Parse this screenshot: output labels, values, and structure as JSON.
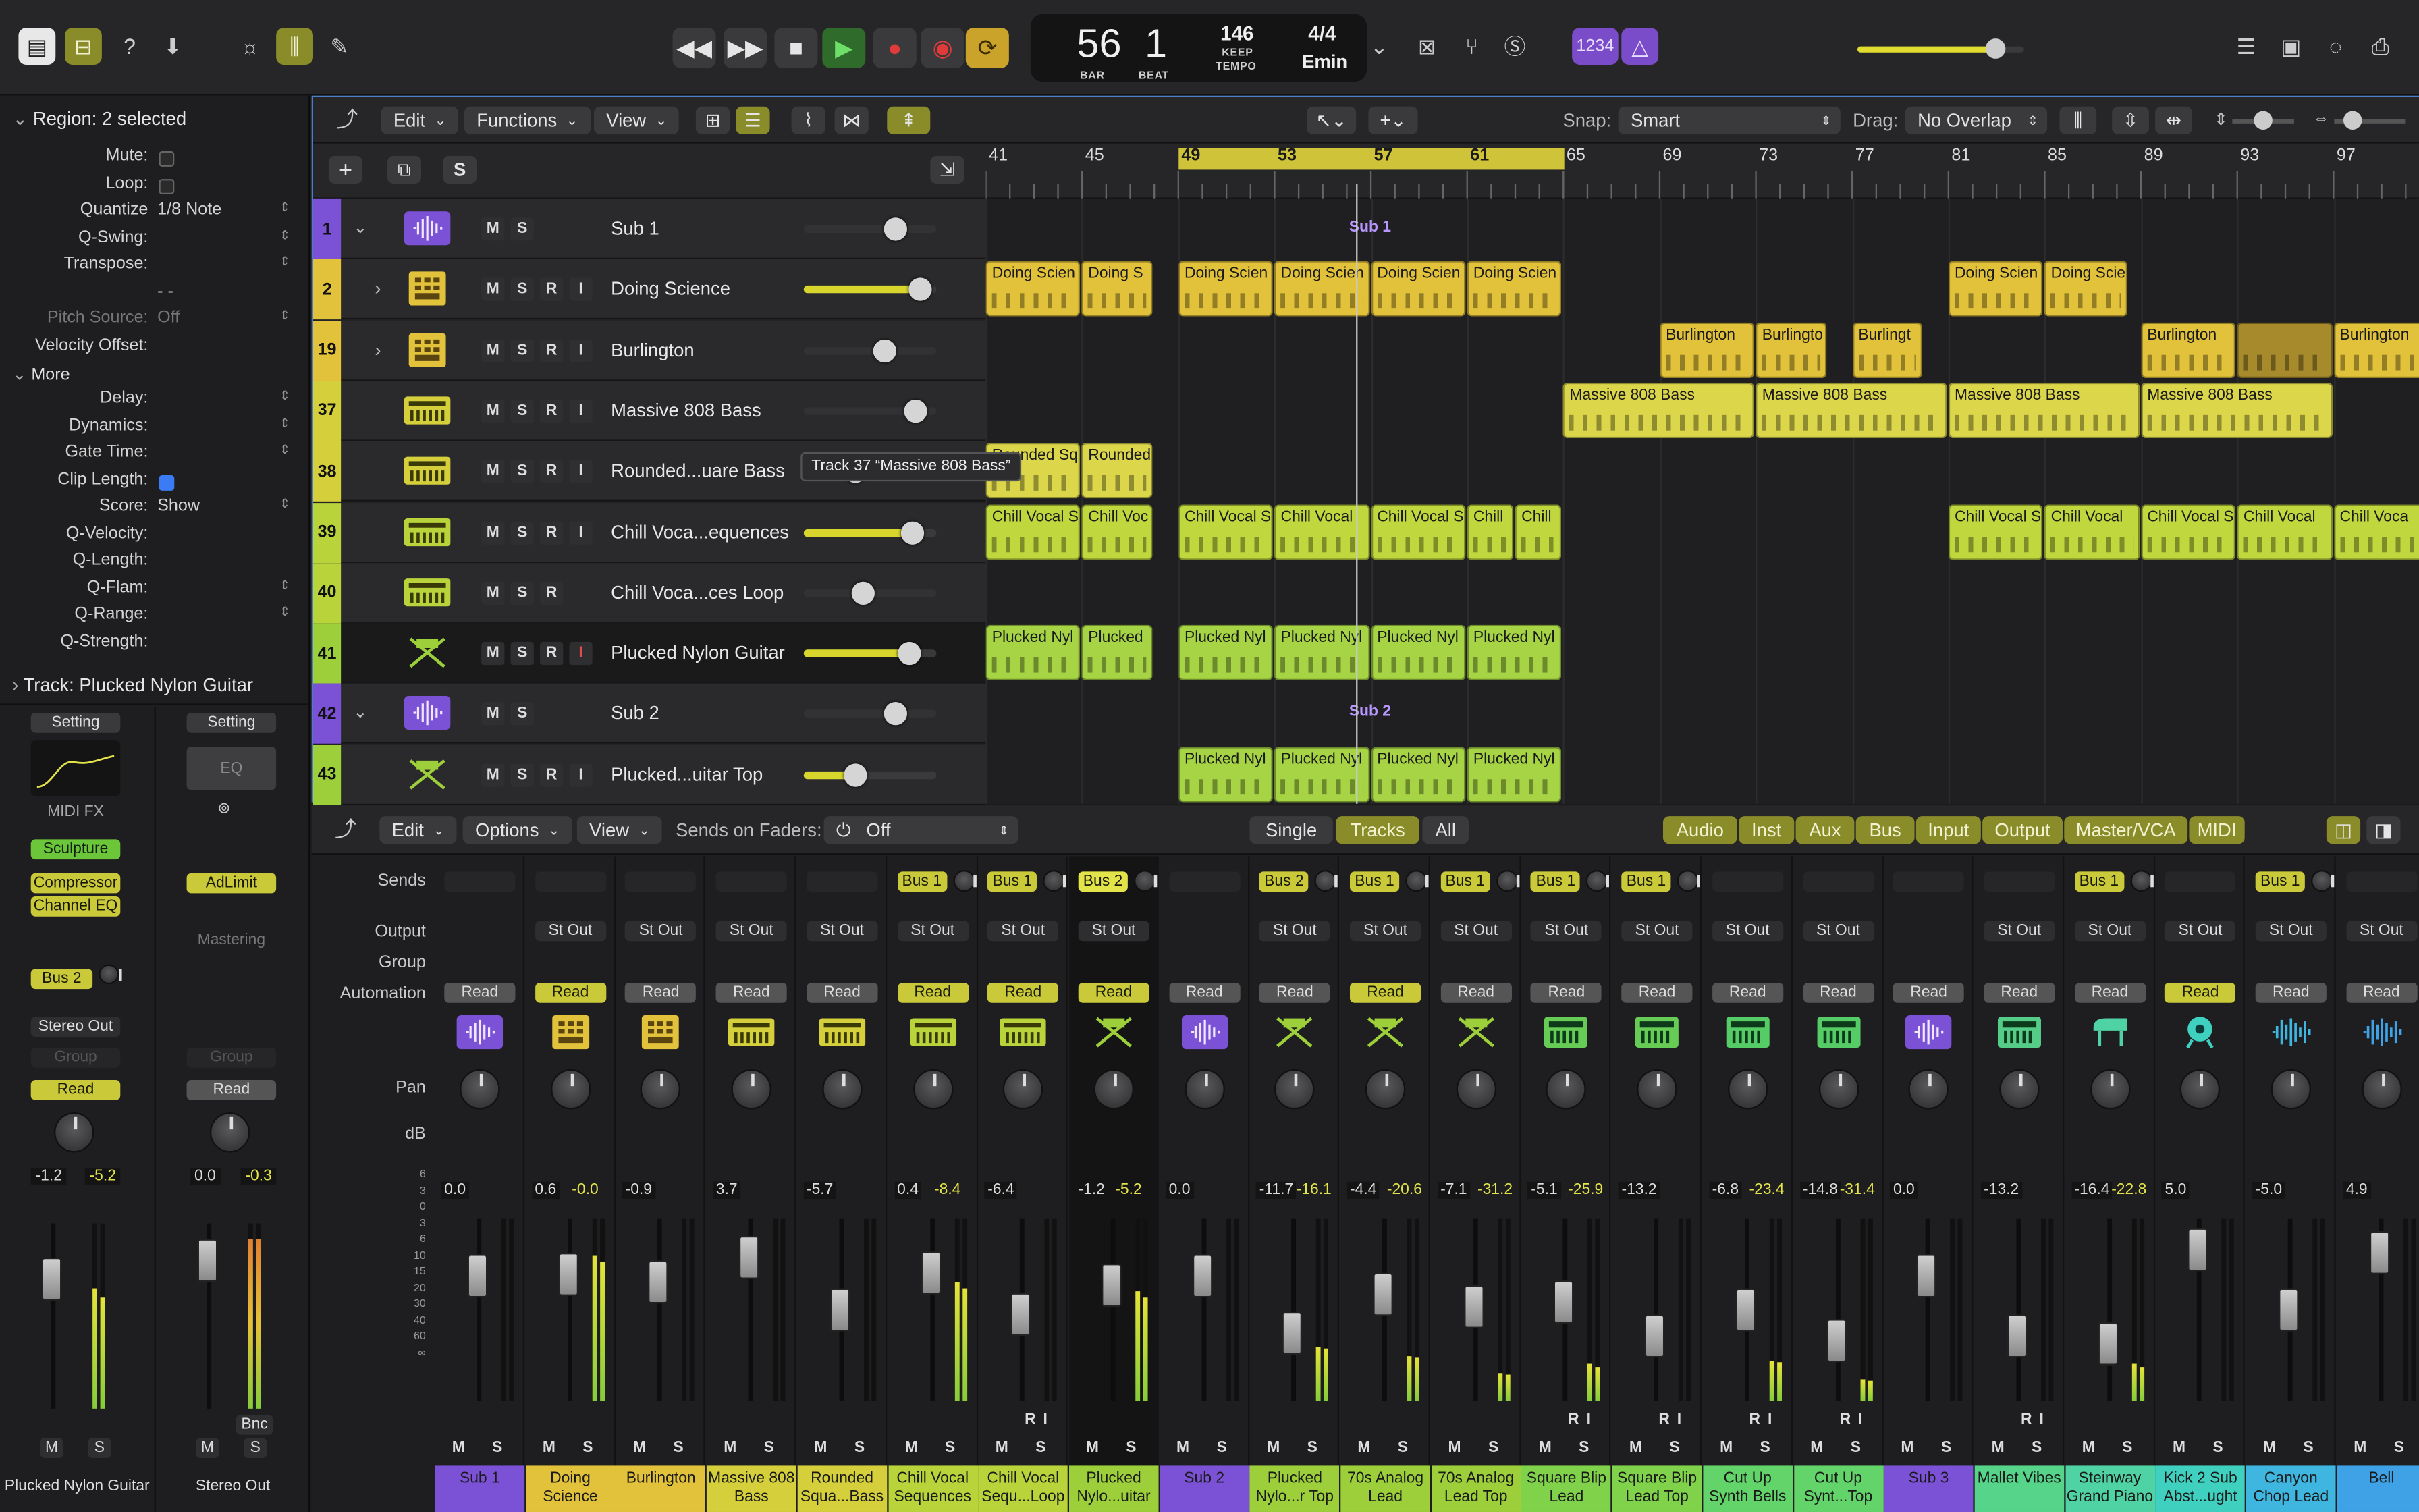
{
  "toolbar": {
    "lcd": {
      "bar": "56",
      "beat": "1",
      "bar_label": "BAR",
      "beat_label": "BEAT",
      "tempo": "146",
      "tempo_mode": "KEEP",
      "tempo_label": "TEMPO",
      "signature": "4/4",
      "key": "Emin"
    },
    "counter_label": "1234",
    "icons": [
      "library-icon",
      "inspector-icon",
      "help-icon",
      "download-icon",
      "smart-controls-icon",
      "mixer-icon",
      "editor-icon",
      "rewind-icon",
      "forward-icon",
      "stop-icon",
      "play-icon",
      "record-icon",
      "capture-icon",
      "cycle-icon",
      "list-icon",
      "notes-icon",
      "loop-browser-icon",
      "browser-icon"
    ],
    "master_volume": 0.82
  },
  "inspector": {
    "region_header": "Region:",
    "region_value": "2 selected",
    "rows": [
      {
        "label": "Mute:",
        "type": "check",
        "on": false
      },
      {
        "label": "Loop:",
        "type": "check",
        "on": false
      },
      {
        "label": "Quantize",
        "value": "1/8 Note"
      },
      {
        "label": "Q-Swing:",
        "value": ""
      },
      {
        "label": "Transpose:",
        "value": ""
      },
      {
        "label": "",
        "value": "- -"
      },
      {
        "label": "Pitch Source:",
        "value": "Off",
        "dim": true
      },
      {
        "label": "Velocity Offset:",
        "value": ""
      }
    ],
    "more_label": "More",
    "more_rows": [
      {
        "label": "Delay:",
        "value": ""
      },
      {
        "label": "Dynamics:",
        "value": ""
      },
      {
        "label": "Gate Time:",
        "value": ""
      },
      {
        "label": "Clip Length:",
        "type": "check",
        "on": true
      },
      {
        "label": "Score:",
        "value": "Show"
      },
      {
        "label": "Q-Velocity:",
        "value": ""
      },
      {
        "label": "Q-Length:",
        "value": ""
      },
      {
        "label": "Q-Flam:",
        "value": ""
      },
      {
        "label": "Q-Range:",
        "value": ""
      },
      {
        "label": "Q-Strength:",
        "value": ""
      }
    ],
    "track_header": "Track:",
    "track_value": "Plucked Nylon Guitar",
    "strip1": {
      "setting": "Setting",
      "midi_fx": "MIDI FX",
      "plugins": [
        "Sculpture",
        "Compressor",
        "Channel EQ"
      ],
      "send": "Bus 2",
      "output": "Stereo Out",
      "group": "Group",
      "automation": "Read",
      "db1": "-1.2",
      "db2": "-5.2",
      "name": "Plucked Nylon Guitar",
      "m": "M",
      "s": "S"
    },
    "strip2": {
      "setting": "Setting",
      "eq": "EQ",
      "plugins": [
        "AdLimit"
      ],
      "mastering": "Mastering",
      "group": "Group",
      "automation": "Read",
      "db1": "0.0",
      "db2": "-0.3",
      "bnc": "Bnc",
      "name": "Stereo Out",
      "m": "M",
      "s": "S"
    }
  },
  "tracks_toolbar": {
    "edit": "Edit",
    "functions": "Functions",
    "view": "View",
    "snap_label": "Snap:",
    "snap_value": "Smart",
    "drag_label": "Drag:",
    "drag_value": "No Overlap"
  },
  "ruler": [
    "41",
    "45",
    "49",
    "53",
    "57",
    "61",
    "65",
    "69",
    "73",
    "77",
    "81",
    "85",
    "89",
    "93",
    "97"
  ],
  "tracks": [
    {
      "num": "1",
      "name": "Sub 1",
      "color": "#7b52d6",
      "type": "summing",
      "vol": null,
      "knob": 0.7,
      "buttons": [
        "M",
        "S"
      ]
    },
    {
      "num": "2",
      "name": "Doing Science",
      "color": "#e2c23a",
      "type": "drum",
      "vol": 0.88,
      "buttons": [
        "M",
        "S",
        "R",
        "I"
      ]
    },
    {
      "num": "19",
      "name": "Burlington",
      "color": "#e2c23a",
      "type": "drum",
      "vol": null,
      "knob": 0.62,
      "buttons": [
        "M",
        "S",
        "R",
        "I"
      ]
    },
    {
      "num": "37",
      "name": "Massive 808 Bass",
      "color": "#d4cf3b",
      "type": "synth",
      "vol": null,
      "knob": 0.85,
      "buttons": [
        "M",
        "S",
        "R",
        "I"
      ]
    },
    {
      "num": "38",
      "name": "Rounded...uare Bass",
      "color": "#d4cf3b",
      "type": "synth",
      "vol": null,
      "knob": 0.4,
      "buttons": [
        "M",
        "S",
        "R",
        "I"
      ]
    },
    {
      "num": "39",
      "name": "Chill Voca...equences",
      "color": "#b9d43a",
      "type": "synth",
      "vol": 0.83,
      "buttons": [
        "M",
        "S",
        "R",
        "I"
      ]
    },
    {
      "num": "40",
      "name": "Chill Voca...ces Loop",
      "color": "#b9d43a",
      "type": "synth",
      "vol": null,
      "knob": 0.45,
      "buttons": [
        "M",
        "S",
        "R"
      ]
    },
    {
      "num": "41",
      "name": "Plucked Nylon Guitar",
      "color": "#9ccf3a",
      "type": "guitar",
      "vol": 0.8,
      "buttons": [
        "M",
        "S",
        "R",
        "I"
      ]
    },
    {
      "num": "42",
      "name": "Sub 2",
      "color": "#7b52d6",
      "type": "summing",
      "vol": null,
      "knob": 0.7,
      "buttons": [
        "M",
        "S"
      ]
    },
    {
      "num": "43",
      "name": "Plucked...uitar Top",
      "color": "#9ccf3a",
      "type": "guitar",
      "vol": 0.4,
      "buttons": [
        "M",
        "S",
        "R",
        "I"
      ]
    }
  ],
  "tooltip": "Track 37 “Massive 808 Bass”",
  "regions": [
    {
      "row": 0,
      "label": "Sub 1",
      "start": 49,
      "end": 65,
      "kind": "sub"
    },
    {
      "row": 1,
      "label": "Doing Scien",
      "start": 41,
      "end": 45,
      "color": "#e2c23a"
    },
    {
      "row": 1,
      "label": "Doing S",
      "start": 45,
      "end": 48,
      "color": "#e2c23a"
    },
    {
      "row": 1,
      "label": "Doing Scien",
      "start": 49,
      "end": 53,
      "color": "#e2c23a"
    },
    {
      "row": 1,
      "label": "Doing Scien",
      "start": 53,
      "end": 57,
      "color": "#e2c23a"
    },
    {
      "row": 1,
      "label": "Doing Scien",
      "start": 57,
      "end": 61,
      "color": "#e2c23a"
    },
    {
      "row": 1,
      "label": "Doing Scien",
      "start": 61,
      "end": 65,
      "color": "#e2c23a"
    },
    {
      "row": 1,
      "label": "Doing Scien",
      "start": 81,
      "end": 85,
      "color": "#e2c23a"
    },
    {
      "row": 1,
      "label": "Doing Scie",
      "start": 85,
      "end": 88.5,
      "color": "#e2c23a"
    },
    {
      "row": 2,
      "label": "Burlington",
      "start": 69,
      "end": 73,
      "color": "#e2c23a"
    },
    {
      "row": 2,
      "label": "Burlingto",
      "start": 73,
      "end": 76,
      "color": "#e2c23a"
    },
    {
      "row": 2,
      "label": "Burlingt",
      "start": 77,
      "end": 80,
      "color": "#e2c23a"
    },
    {
      "row": 2,
      "label": "Burlington",
      "start": 89,
      "end": 93,
      "color": "#e2c23a"
    },
    {
      "row": 2,
      "label": "",
      "start": 93,
      "end": 97,
      "color": "#a68a2c"
    },
    {
      "row": 2,
      "label": "Burlington",
      "start": 97,
      "end": 101,
      "color": "#e2c23a"
    },
    {
      "row": 3,
      "label": "Massive 808 Bass",
      "start": 65,
      "end": 73,
      "color": "#dcd64a"
    },
    {
      "row": 3,
      "label": "Massive 808 Bass",
      "start": 73,
      "end": 81,
      "color": "#dcd64a"
    },
    {
      "row": 3,
      "label": "Massive 808 Bass",
      "start": 81,
      "end": 89,
      "color": "#dcd64a"
    },
    {
      "row": 3,
      "label": "Massive 808 Bass",
      "start": 89,
      "end": 97,
      "color": "#dcd64a"
    },
    {
      "row": 4,
      "label": "Rounded Sq",
      "start": 41,
      "end": 45,
      "color": "#dcd64a"
    },
    {
      "row": 4,
      "label": "Rounded",
      "start": 45,
      "end": 48,
      "color": "#dcd64a"
    },
    {
      "row": 5,
      "label": "Chill Vocal S",
      "start": 41,
      "end": 45,
      "color": "#c0d83e"
    },
    {
      "row": 5,
      "label": "Chill Voc",
      "start": 45,
      "end": 48,
      "color": "#c0d83e"
    },
    {
      "row": 5,
      "label": "Chill Vocal S",
      "start": 49,
      "end": 53,
      "color": "#c0d83e"
    },
    {
      "row": 5,
      "label": "Chill Vocal",
      "start": 53,
      "end": 57,
      "color": "#c0d83e"
    },
    {
      "row": 5,
      "label": "Chill Vocal S",
      "start": 57,
      "end": 61,
      "color": "#c0d83e"
    },
    {
      "row": 5,
      "label": "Chill",
      "start": 61,
      "end": 63,
      "color": "#c0d83e"
    },
    {
      "row": 5,
      "label": "Chill",
      "start": 63,
      "end": 65,
      "color": "#c0d83e"
    },
    {
      "row": 5,
      "label": "Chill Vocal S",
      "start": 81,
      "end": 85,
      "color": "#c0d83e"
    },
    {
      "row": 5,
      "label": "Chill Vocal",
      "start": 85,
      "end": 89,
      "color": "#c0d83e"
    },
    {
      "row": 5,
      "label": "Chill Vocal S",
      "start": 89,
      "end": 93,
      "color": "#c0d83e"
    },
    {
      "row": 5,
      "label": "Chill Vocal",
      "start": 93,
      "end": 97,
      "color": "#c0d83e"
    },
    {
      "row": 5,
      "label": "Chill Voca",
      "start": 97,
      "end": 101,
      "color": "#c0d83e"
    },
    {
      "row": 7,
      "label": "Plucked Nyl",
      "start": 41,
      "end": 45,
      "color": "#a6d444"
    },
    {
      "row": 7,
      "label": "Plucked",
      "start": 45,
      "end": 48,
      "color": "#a6d444"
    },
    {
      "row": 7,
      "label": "Plucked Nyl",
      "start": 49,
      "end": 53,
      "color": "#a6d444"
    },
    {
      "row": 7,
      "label": "Plucked Nyl",
      "start": 53,
      "end": 57,
      "color": "#a6d444"
    },
    {
      "row": 7,
      "label": "Plucked Nyl",
      "start": 57,
      "end": 61,
      "color": "#a6d444"
    },
    {
      "row": 7,
      "label": "Plucked Nyl",
      "start": 61,
      "end": 65,
      "color": "#a6d444"
    },
    {
      "row": 8,
      "label": "Sub 2",
      "start": 49,
      "end": 65,
      "kind": "sub"
    },
    {
      "row": 9,
      "label": "Plucked Nyl",
      "start": 49,
      "end": 53,
      "color": "#a6d444"
    },
    {
      "row": 9,
      "label": "Plucked Nyl",
      "start": 53,
      "end": 57,
      "color": "#a6d444"
    },
    {
      "row": 9,
      "label": "Plucked Nyl",
      "start": 57,
      "end": 61,
      "color": "#a6d444"
    },
    {
      "row": 9,
      "label": "Plucked Nyl",
      "start": 61,
      "end": 65,
      "color": "#a6d444"
    }
  ],
  "mixer_toolbar": {
    "edit": "Edit",
    "options": "Options",
    "view": "View",
    "sends_label": "Sends on Faders:",
    "sends_value": "Off",
    "modes": [
      "Single",
      "Tracks",
      "All"
    ],
    "filters": [
      "Audio",
      "Inst",
      "Aux",
      "Bus",
      "Input",
      "Output",
      "Master/VCA",
      "MIDI"
    ]
  },
  "mixer_labels": {
    "sends": "Sends",
    "output": "Output",
    "group": "Group",
    "automation": "Automation",
    "pan": "Pan",
    "db": "dB"
  },
  "strips": [
    {
      "name": "Sub 1",
      "color": "#7b52d6",
      "send": "",
      "output": "",
      "auto": "Read",
      "autoOn": false,
      "db1": "0.0",
      "db2": "",
      "fader": 0.72,
      "meter": 0,
      "icon": "summing",
      "iconColor": "#7b52d6"
    },
    {
      "name": "Doing Science",
      "color": "#e2c23a",
      "send": "",
      "output": "St Out",
      "auto": "Read",
      "autoOn": true,
      "db1": "0.6",
      "db2": "-0.0",
      "fader": 0.73,
      "meter": 0.8,
      "icon": "drum",
      "iconColor": "#e2c23a"
    },
    {
      "name": "Burlington",
      "color": "#e2c23a",
      "send": "",
      "output": "St Out",
      "auto": "Read",
      "autoOn": false,
      "db1": "-0.9",
      "db2": "",
      "fader": 0.68,
      "meter": 0,
      "icon": "drum",
      "iconColor": "#e2c23a"
    },
    {
      "name": "Massive 808 Bass",
      "color": "#d4cf3b",
      "send": "",
      "output": "St Out",
      "auto": "Read",
      "autoOn": false,
      "db1": "3.7",
      "db2": "",
      "fader": 0.85,
      "meter": 0,
      "icon": "synth",
      "iconColor": "#d4cf3b"
    },
    {
      "name": "Rounded Squa...Bass",
      "color": "#d4cf3b",
      "send": "",
      "output": "St Out",
      "auto": "Read",
      "autoOn": false,
      "db1": "-5.7",
      "db2": "",
      "fader": 0.5,
      "meter": 0,
      "icon": "synth",
      "iconColor": "#d4cf3b"
    },
    {
      "name": "Chill Vocal Sequences",
      "color": "#b9d43a",
      "send": "Bus 1",
      "output": "St Out",
      "auto": "Read",
      "autoOn": true,
      "db1": "0.4",
      "db2": "-8.4",
      "fader": 0.75,
      "meter": 0.65,
      "icon": "synth",
      "iconColor": "#b9d43a"
    },
    {
      "name": "Chill Vocal Sequ...Loop",
      "color": "#b9d43a",
      "send": "Bus 1",
      "output": "St Out",
      "auto": "Read",
      "autoOn": true,
      "db1": "-6.4",
      "db2": "",
      "fader": 0.47,
      "meter": 0,
      "icon": "synth",
      "iconColor": "#b9d43a",
      "ri": true
    },
    {
      "name": "Plucked Nylo...uitar",
      "color": "#9ccf3a",
      "send": "Bus 2",
      "sendHi": true,
      "output": "St Out",
      "auto": "Read",
      "autoOn": true,
      "db1": "-1.2",
      "db2": "-5.2",
      "fader": 0.66,
      "meter": 0.6,
      "icon": "guitar",
      "iconColor": "#9ccf3a",
      "selected": true
    },
    {
      "name": "Sub 2",
      "color": "#7b52d6",
      "send": "",
      "output": "",
      "auto": "Read",
      "autoOn": false,
      "db1": "0.0",
      "db2": "",
      "fader": 0.72,
      "meter": 0,
      "icon": "summing",
      "iconColor": "#7b52d6"
    },
    {
      "name": "Plucked Nylo...r Top",
      "color": "#9ccf3a",
      "send": "Bus 2",
      "output": "St Out",
      "auto": "Read",
      "autoOn": false,
      "db1": "-11.7",
      "db2": "-16.1",
      "fader": 0.35,
      "meter": 0.3,
      "icon": "guitar",
      "iconColor": "#9ccf3a"
    },
    {
      "name": "70s Analog Lead",
      "color": "#9ccf3a",
      "send": "Bus 1",
      "output": "St Out",
      "auto": "Read",
      "autoOn": true,
      "db1": "-4.4",
      "db2": "-20.6",
      "fader": 0.6,
      "meter": 0.25,
      "icon": "guitar",
      "iconColor": "#9ccf3a"
    },
    {
      "name": "70s Analog Lead Top",
      "color": "#9ccf3a",
      "send": "Bus 1",
      "output": "St Out",
      "auto": "Read",
      "autoOn": false,
      "db1": "-7.1",
      "db2": "-31.2",
      "fader": 0.52,
      "meter": 0.15,
      "icon": "guitar",
      "iconColor": "#9ccf3a"
    },
    {
      "name": "Square Blip Lead",
      "color": "#7fd24a",
      "send": "Bus 1",
      "output": "St Out",
      "auto": "Read",
      "autoOn": false,
      "db1": "-5.1",
      "db2": "-25.9",
      "fader": 0.55,
      "meter": 0.2,
      "icon": "keys",
      "iconColor": "#66cc55",
      "ri": true
    },
    {
      "name": "Square Blip Lead Top",
      "color": "#7fd24a",
      "send": "Bus 1",
      "output": "St Out",
      "auto": "Read",
      "autoOn": false,
      "db1": "-13.2",
      "db2": "",
      "fader": 0.33,
      "meter": 0,
      "icon": "keys",
      "iconColor": "#66cc55",
      "ri": true
    },
    {
      "name": "Cut Up Synth Bells",
      "color": "#62d46a",
      "send": "",
      "output": "St Out",
      "auto": "Read",
      "autoOn": false,
      "db1": "-6.8",
      "db2": "-23.4",
      "fader": 0.5,
      "meter": 0.22,
      "icon": "keys",
      "iconColor": "#55cc66",
      "ri": true
    },
    {
      "name": "Cut Up Synt...Top",
      "color": "#62d46a",
      "send": "",
      "output": "St Out",
      "auto": "Read",
      "autoOn": false,
      "db1": "-14.8",
      "db2": "-31.4",
      "fader": 0.3,
      "meter": 0.12,
      "icon": "keys",
      "iconColor": "#55cc66",
      "ri": true
    },
    {
      "name": "Sub 3",
      "color": "#7b52d6",
      "send": "",
      "output": "",
      "auto": "Read",
      "autoOn": false,
      "db1": "0.0",
      "db2": "",
      "fader": 0.72,
      "meter": 0,
      "icon": "summing",
      "iconColor": "#7b52d6"
    },
    {
      "name": "Mallet Vibes",
      "color": "#55d48a",
      "send": "",
      "output": "St Out",
      "auto": "Read",
      "autoOn": false,
      "db1": "-13.2",
      "db2": "",
      "fader": 0.33,
      "meter": 0,
      "icon": "keys",
      "iconColor": "#55cc88",
      "ri": true
    },
    {
      "name": "Steinway Grand Piano",
      "color": "#4fd2a4",
      "send": "Bus 1",
      "output": "St Out",
      "auto": "Read",
      "autoOn": false,
      "db1": "-16.4",
      "db2": "-22.8",
      "fader": 0.28,
      "meter": 0.2,
      "icon": "piano",
      "iconColor": "#4fd2a4"
    },
    {
      "name": "Kick 2 Sub Abst...ught",
      "color": "#3fd0c0",
      "send": "",
      "output": "St Out",
      "auto": "Read",
      "autoOn": true,
      "db1": "5.0",
      "db2": "",
      "fader": 0.9,
      "meter": 0,
      "icon": "drum2",
      "iconColor": "#3fd0c0"
    },
    {
      "name": "Canyon Chop Lead",
      "color": "#3fb6e0",
      "send": "Bus 1",
      "output": "St Out",
      "auto": "Read",
      "autoOn": false,
      "db1": "-5.0",
      "db2": "",
      "fader": 0.5,
      "meter": 0,
      "icon": "wave",
      "iconColor": "#3fb6e0"
    },
    {
      "name": "Bell",
      "color": "#3fa2e6",
      "send": "",
      "output": "St Out",
      "auto": "Read",
      "autoOn": false,
      "db1": "4.9",
      "db2": "",
      "fader": 0.88,
      "meter": 0,
      "icon": "wave",
      "iconColor": "#3fa2e6"
    }
  ],
  "scale_marks": [
    "6",
    "3",
    "0",
    "3",
    "6",
    "10",
    "15",
    "20",
    "30",
    "40",
    "60",
    "∞"
  ],
  "strip_buttons": {
    "m": "M",
    "s": "S",
    "r": "R",
    "i": "I"
  }
}
